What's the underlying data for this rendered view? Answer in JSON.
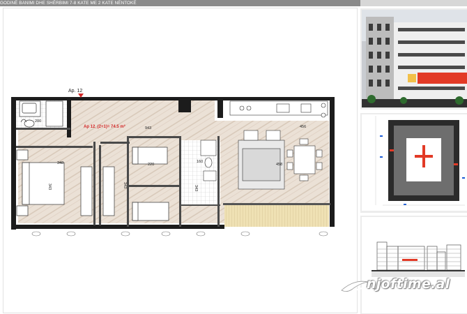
{
  "header": {
    "title": "GODINË BANIMI DHE SHËRBIMI 7-8 KATE ME 2 KATE NËNTOKË"
  },
  "plan": {
    "apartment_tag": "Ap. 12",
    "apartment_label": "Ap 12_(2+1)= 74.5 m²",
    "dims": {
      "bath_top": "200",
      "hall": "943",
      "living_top": "456",
      "bedroom1_width": "348",
      "bedroom1_height": "343",
      "bedroom2_width": "220",
      "bedroom2_height": "343",
      "wc_width": "160",
      "wc_height": "343",
      "living_width": "458"
    }
  },
  "watermark": {
    "text": "njoftime.al"
  },
  "colors": {
    "header_bg": "#8b8b8b",
    "floor_wood": "#e8ddd2",
    "wall": "#1c1c1c",
    "balcony": "#ecdcaa",
    "label_red": "#d42a2a",
    "facade_red": "#e23a26"
  }
}
